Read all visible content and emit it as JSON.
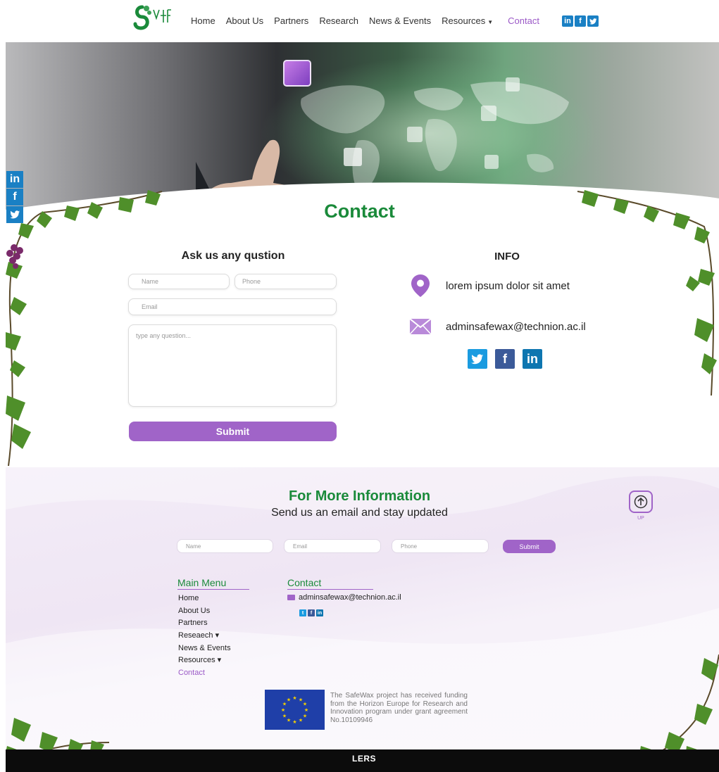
{
  "nav": {
    "items": [
      {
        "label": "Home"
      },
      {
        "label": "About Us"
      },
      {
        "label": "Partners"
      },
      {
        "label": "Research"
      },
      {
        "label": "News & Events"
      },
      {
        "label": "Resources",
        "dropdown": true
      },
      {
        "label": "Contact",
        "active": true
      }
    ],
    "social": [
      "linkedin-icon",
      "facebook-icon",
      "twitter-icon"
    ]
  },
  "page_title": "Contact",
  "form": {
    "title": "Ask us any qustion",
    "name_placeholder": "Name",
    "phone_placeholder": "Phone",
    "email_placeholder": "Email",
    "question_placeholder": "type any question...",
    "submit_label": "Submit"
  },
  "info": {
    "title": "INFO",
    "address": "lorem ipsum dolor sit amet",
    "email": "adminsafewax@technion.ac.il"
  },
  "newsletter": {
    "title": "For More Information",
    "subtitle": "Send us an email and stay updated",
    "name_placeholder": "Name",
    "email_placeholder": "Email",
    "phone_placeholder": "Phone",
    "submit_label": "Submit",
    "up_label": "UP"
  },
  "footer": {
    "main_menu_title": "Main Menu",
    "main_menu": [
      {
        "label": "Home"
      },
      {
        "label": "About Us"
      },
      {
        "label": "Partners"
      },
      {
        "label": "Reseaech ▾"
      },
      {
        "label": "News & Events"
      },
      {
        "label": "Resources ▾"
      },
      {
        "label": "Contact",
        "active": true
      }
    ],
    "contact_title": "Contact",
    "contact_email": "adminsafewax@technion.ac.il",
    "eu_text": "The SafeWax project has received funding from the Horizon Europe for Research and Innovation program under grant agreement No.10109946",
    "bottom_logo": "LERS"
  },
  "colors": {
    "accent_purple": "#a064c8",
    "brand_green": "#1a8a3a",
    "social_blue": "#1a80c4"
  }
}
